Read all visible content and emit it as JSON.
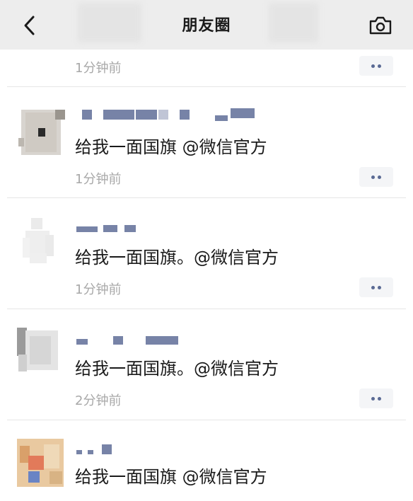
{
  "header": {
    "title": "朋友圈",
    "back_icon": "chevron-left-icon",
    "camera_icon": "camera-icon"
  },
  "first_row": {
    "time": "1分钟前"
  },
  "posts": [
    {
      "text": "给我一面国旗 @微信官方",
      "time": "1分钟前"
    },
    {
      "text": "给我一面国旗。@微信官方",
      "time": "1分钟前"
    },
    {
      "text": "给我一面国旗。@微信官方",
      "time": "2分钟前"
    },
    {
      "text": "给我一面国旗 @微信官方",
      "time": ""
    }
  ],
  "colors": {
    "topbar": "#ededed",
    "name_link": "#576b95",
    "time": "#a8a8a8",
    "divider": "#e6e6e6"
  }
}
